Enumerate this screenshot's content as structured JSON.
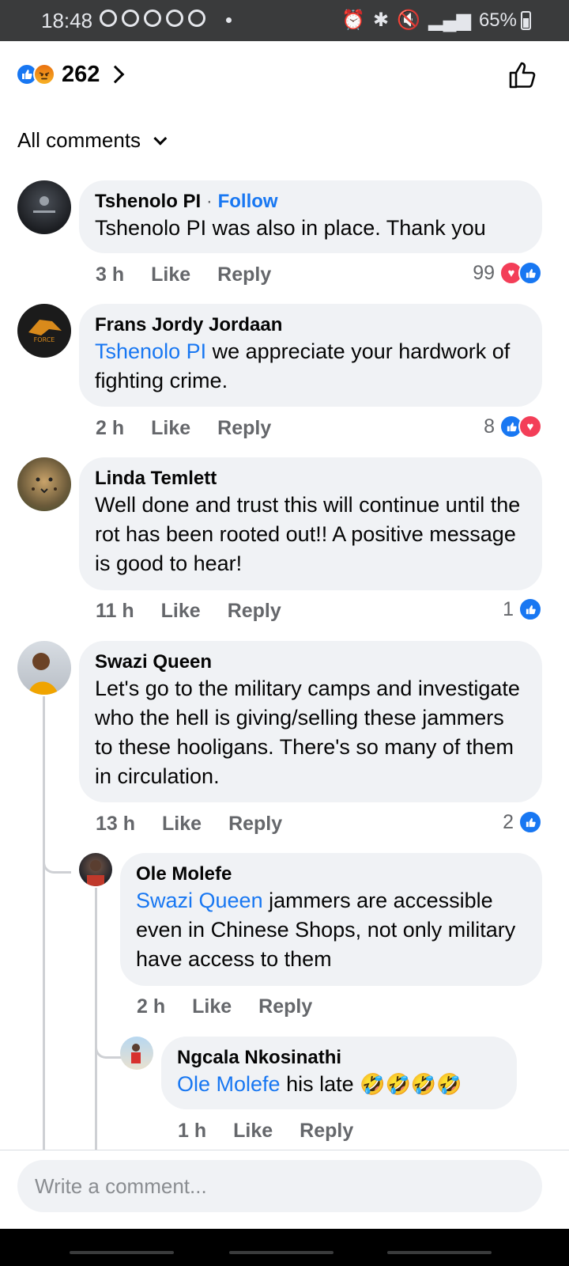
{
  "status_bar": {
    "time": "18:48",
    "battery": "65%"
  },
  "header": {
    "reaction_count": "262",
    "reactions": [
      "like-icon",
      "angry-icon"
    ]
  },
  "filter": {
    "label": "All comments"
  },
  "comments": [
    {
      "author": "Tshenolo PI",
      "follow_label": "Follow",
      "text": "Tshenolo PI was also in place. Thank you",
      "time": "3 h",
      "like_label": "Like",
      "reply_label": "Reply",
      "reaction_count": "99",
      "reactions": [
        "love",
        "like"
      ]
    },
    {
      "author": "Frans Jordy Jordaan",
      "mention": "Tshenolo PI",
      "text": " we appreciate your hardwork of fighting crime.",
      "time": "2 h",
      "like_label": "Like",
      "reply_label": "Reply",
      "reaction_count": "8",
      "reactions": [
        "like",
        "love"
      ]
    },
    {
      "author": "Linda Temlett",
      "text": "Well done and trust this will continue until the rot has been rooted out!! A positive message is good to hear!",
      "time": "11 h",
      "like_label": "Like",
      "reply_label": "Reply",
      "reaction_count": "1",
      "reactions": [
        "like"
      ]
    },
    {
      "author": "Swazi Queen",
      "text": "Let's go to the military camps and investigate who the hell is giving/selling these jammers to these hooligans. There's so many of them in circulation.",
      "time": "13 h",
      "like_label": "Like",
      "reply_label": "Reply",
      "reaction_count": "2",
      "reactions": [
        "like"
      ]
    },
    {
      "author": "Ole Molefe",
      "mention": "Swazi Queen",
      "text": " jammers are accessible even in Chinese Shops, not only military have access to them",
      "time": "2 h",
      "like_label": "Like",
      "reply_label": "Reply"
    },
    {
      "author": "Ngcala Nkosinathi",
      "mention": "Ole Molefe",
      "text": " his late ",
      "emoji": "🤣🤣🤣🤣",
      "time": "1 h",
      "like_label": "Like",
      "reply_label": "Reply"
    }
  ],
  "composer": {
    "placeholder": "Write a comment..."
  },
  "colors": {
    "accent": "#1877f2",
    "bubble": "#f0f2f5",
    "love": "#f33e58"
  }
}
